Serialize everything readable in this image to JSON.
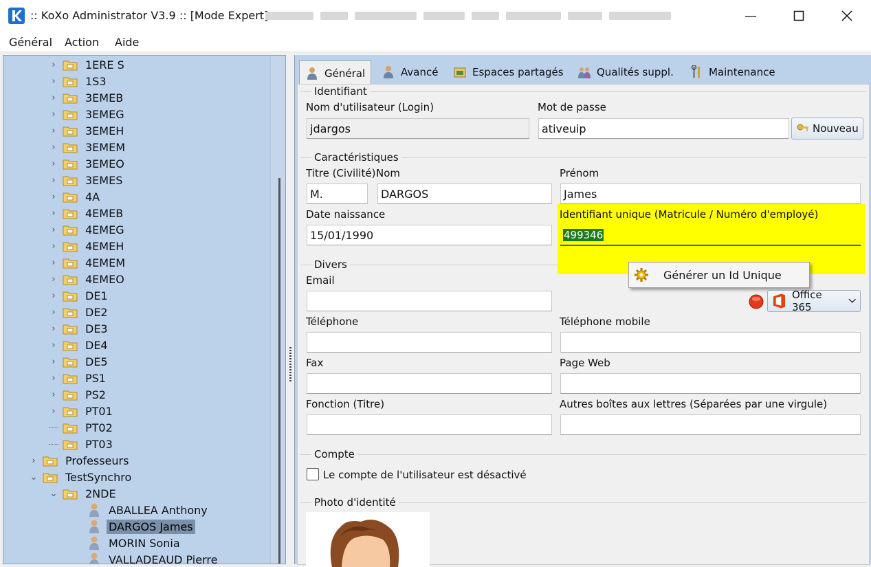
{
  "window": {
    "title": ":: KoXo Administrator V3.9 :: [Mode Expert]"
  },
  "menu": [
    "Général",
    "Action",
    "Aide"
  ],
  "tree": {
    "classes": [
      "1ERE S",
      "1S3",
      "3EMEB",
      "3EMEG",
      "3EMEH",
      "3EMEM",
      "3EMEO",
      "3EMES",
      "4A",
      "4EMEB",
      "4EMEG",
      "4EMEH",
      "4EMEM",
      "4EMEO",
      "DE1",
      "DE2",
      "DE3",
      "DE4",
      "DE5",
      "PS1",
      "PS2",
      "PT01",
      "PT02",
      "PT03"
    ],
    "professeurs": "Professeurs",
    "testsynchro": "TestSynchro",
    "group_2nde": "2NDE",
    "users": [
      "ABALLEA Anthony",
      "DARGOS James",
      "MORIN Sonia",
      "VALLADEAUD Pierre"
    ]
  },
  "tabs": [
    "Général",
    "Avancé",
    "Espaces partagés",
    "Qualités suppl.",
    "Maintenance"
  ],
  "identifiant": {
    "group_title": "Identifiant",
    "login_label": "Nom d'utilisateur (Login)",
    "login_value": "jdargos",
    "password_label": "Mot de passe",
    "password_value": "ativeuip",
    "new_button": "Nouveau"
  },
  "caracteristiques": {
    "group_title": "Caractéristiques",
    "titre_label": "Titre (Civilité)",
    "titre_value": "M.",
    "nom_label": "Nom",
    "nom_value": "DARGOS",
    "prenom_label": "Prénom",
    "prenom_value": "James",
    "date_label": "Date naissance",
    "date_value": "15/01/1990",
    "id_label": "Identifiant unique (Matricule / Numéro d'employé)",
    "id_value": "499346",
    "generate_menu_item": "Générer un Id Unique"
  },
  "divers": {
    "group_title": "Divers",
    "email_label": "Email",
    "email_value": "",
    "office_button": "Office 365",
    "tel_label": "Téléphone",
    "mobile_label": "Téléphone mobile",
    "fax_label": "Fax",
    "web_label": "Page Web",
    "fonction_label": "Fonction (Titre)",
    "autres_label": "Autres boîtes aux lettres (Séparées par une virgule)"
  },
  "compte": {
    "group_title": "Compte",
    "disabled_label": "Le compte de l'utilisateur est désactivé",
    "disabled_checked": false
  },
  "photo": {
    "group_title": "Photo d'identité"
  },
  "colors": {
    "highlight": "#ffff00",
    "selected_text_bg": "#1e7a1e",
    "tree_bg": "#bcd1ea"
  }
}
